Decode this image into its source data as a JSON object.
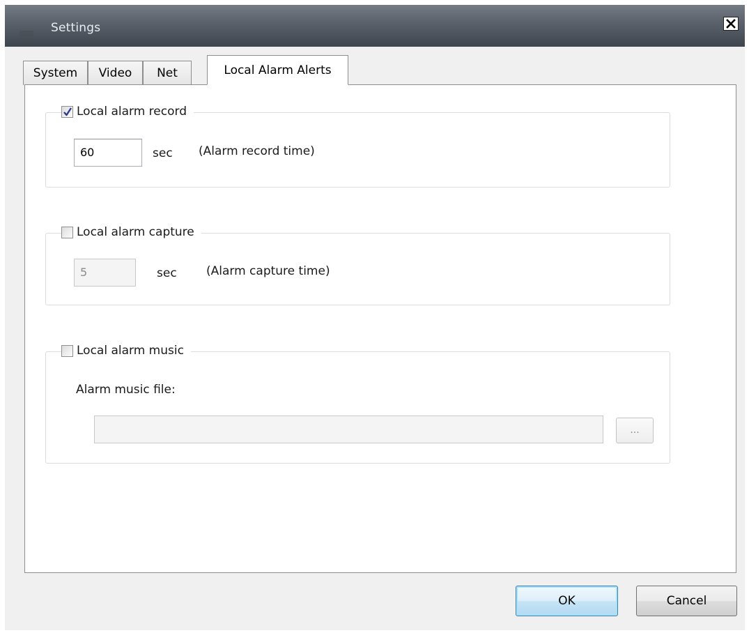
{
  "window": {
    "title": "Settings"
  },
  "tabs": [
    {
      "label": "System",
      "active": false
    },
    {
      "label": "Video",
      "active": false
    },
    {
      "label": "Net",
      "active": false
    },
    {
      "label": "Local Alarm Alerts",
      "active": true
    }
  ],
  "record": {
    "label": "Local alarm record",
    "checked": true,
    "value": "60",
    "unit": "sec",
    "hint": "(Alarm record time)"
  },
  "capture": {
    "label": "Local alarm capture",
    "checked": false,
    "value": "5",
    "unit": "sec",
    "hint": "(Alarm capture time)"
  },
  "music": {
    "label": "Local alarm music",
    "checked": false,
    "file_label": "Alarm music file:",
    "file_value": "",
    "browse_label": "..."
  },
  "buttons": {
    "ok": "OK",
    "cancel": "Cancel"
  },
  "icons": {
    "close": "close-icon",
    "checkmark": "checkmark-icon",
    "app": "app-icon"
  },
  "colors": {
    "titlebar": "#4f565f",
    "ok_border": "#3c7fb1",
    "check": "#2b3a8c"
  }
}
